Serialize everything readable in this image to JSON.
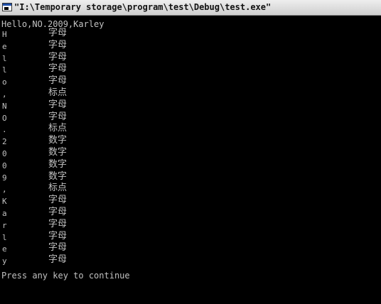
{
  "window": {
    "title": "\"I:\\Temporary storage\\program\\test\\Debug\\test.exe\"",
    "icon": "console-app-icon"
  },
  "console": {
    "header": "Hello,NO.2009,Karley",
    "rows": [
      {
        "char": "H",
        "category": "字母"
      },
      {
        "char": "e",
        "category": "字母"
      },
      {
        "char": "l",
        "category": "字母"
      },
      {
        "char": "l",
        "category": "字母"
      },
      {
        "char": "o",
        "category": "字母"
      },
      {
        "char": ",",
        "category": "标点"
      },
      {
        "char": "N",
        "category": "字母"
      },
      {
        "char": "O",
        "category": "字母"
      },
      {
        "char": ".",
        "category": "标点"
      },
      {
        "char": "2",
        "category": "数字"
      },
      {
        "char": "0",
        "category": "数字"
      },
      {
        "char": "0",
        "category": "数字"
      },
      {
        "char": "9",
        "category": "数字"
      },
      {
        "char": ",",
        "category": "标点"
      },
      {
        "char": "K",
        "category": "字母"
      },
      {
        "char": "a",
        "category": "字母"
      },
      {
        "char": "r",
        "category": "字母"
      },
      {
        "char": "l",
        "category": "字母"
      },
      {
        "char": "e",
        "category": "字母"
      },
      {
        "char": "y",
        "category": "字母"
      }
    ],
    "footer": "Press any key to continue"
  },
  "colors": {
    "background": "#000000",
    "text": "#c0c0c0"
  }
}
